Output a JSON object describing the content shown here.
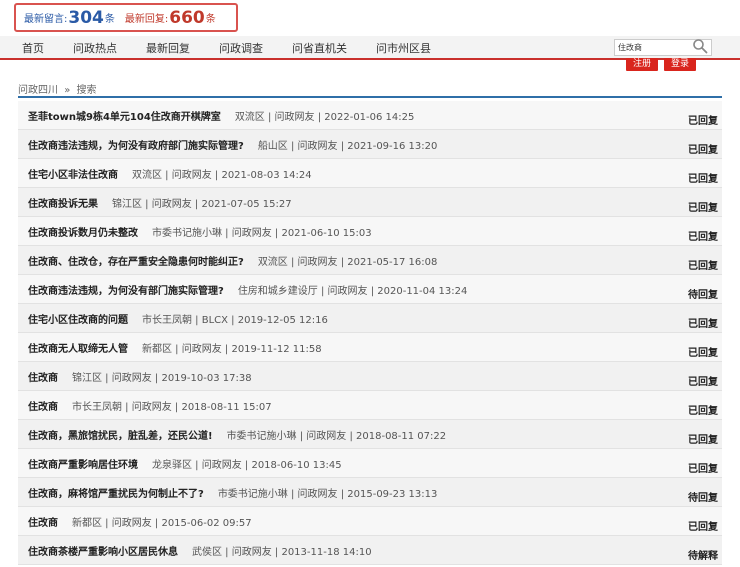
{
  "stats": {
    "latest_msg_label": "最新留言:",
    "latest_msg_count": "304",
    "latest_msg_unit": "条",
    "latest_reply_label": "最新回复:",
    "latest_reply_count": "660",
    "latest_reply_unit": "条"
  },
  "nav": {
    "items": [
      "首页",
      "问政热点",
      "最新回复",
      "问政调查",
      "问省直机关",
      "问市州区县"
    ]
  },
  "search": {
    "value": "住改商"
  },
  "auth": {
    "register": "注册",
    "login": "登录"
  },
  "breadcrumb": {
    "root": "问政四川",
    "sep": "»",
    "current": "搜索"
  },
  "rows": [
    {
      "title": "圣菲town城9栋4单元104住改商开棋牌室",
      "meta": "双流区 | 问政网友 | 2022-01-06 14:25",
      "status": "已回复"
    },
    {
      "title": "住改商违法违规，为何没有政府部门施实际管理?",
      "meta": "船山区 | 问政网友 | 2021-09-16 13:20",
      "status": "已回复"
    },
    {
      "title": "住宅小区非法住改商",
      "meta": "双流区 | 问政网友 | 2021-08-03 14:24",
      "status": "已回复"
    },
    {
      "title": "住改商投诉无果",
      "meta": "锦江区 | 问政网友 | 2021-07-05 15:27",
      "status": "已回复"
    },
    {
      "title": "住改商投诉数月仍未整改",
      "meta": "市委书记施小琳 | 问政网友 | 2021-06-10 15:03",
      "status": "已回复"
    },
    {
      "title": "住改商、住改仓，存在严重安全隐患何时能纠正?",
      "meta": "双流区 | 问政网友 | 2021-05-17 16:08",
      "status": "已回复"
    },
    {
      "title": "住改商违法违规，为何没有部门施实际管理?",
      "meta": "住房和城乡建设厅 | 问政网友 | 2020-11-04 13:24",
      "status": "待回复"
    },
    {
      "title": "住宅小区住改商的问题",
      "meta": "市长王凤朝 | BLCX | 2019-12-05 12:16",
      "status": "已回复"
    },
    {
      "title": "住改商无人取缔无人管",
      "meta": "新都区 | 问政网友 | 2019-11-12 11:58",
      "status": "已回复"
    },
    {
      "title": "住改商",
      "meta": "锦江区 | 问政网友 | 2019-10-03 17:38",
      "status": "已回复"
    },
    {
      "title": "住改商",
      "meta": "市长王凤朝 | 问政网友 | 2018-08-11 15:07",
      "status": "已回复"
    },
    {
      "title": "住改商，黑旅馆扰民，脏乱差，还民公道!",
      "meta": "市委书记施小琳 | 问政网友 | 2018-08-11 07:22",
      "status": "已回复"
    },
    {
      "title": "住改商严重影响居住环境",
      "meta": "龙泉驿区 | 问政网友 | 2018-06-10 13:45",
      "status": "已回复"
    },
    {
      "title": "住改商，麻将馆严重扰民为何制止不了?",
      "meta": "市委书记施小琳 | 问政网友 | 2015-09-23 13:13",
      "status": "待回复"
    },
    {
      "title": "住改商",
      "meta": "新都区 | 问政网友 | 2015-06-02 09:57",
      "status": "已回复"
    },
    {
      "title": "住改商茶楼严重影响小区居民休息",
      "meta": "武侯区 | 问政网友 | 2013-11-18 14:10",
      "status": "待解释"
    }
  ]
}
